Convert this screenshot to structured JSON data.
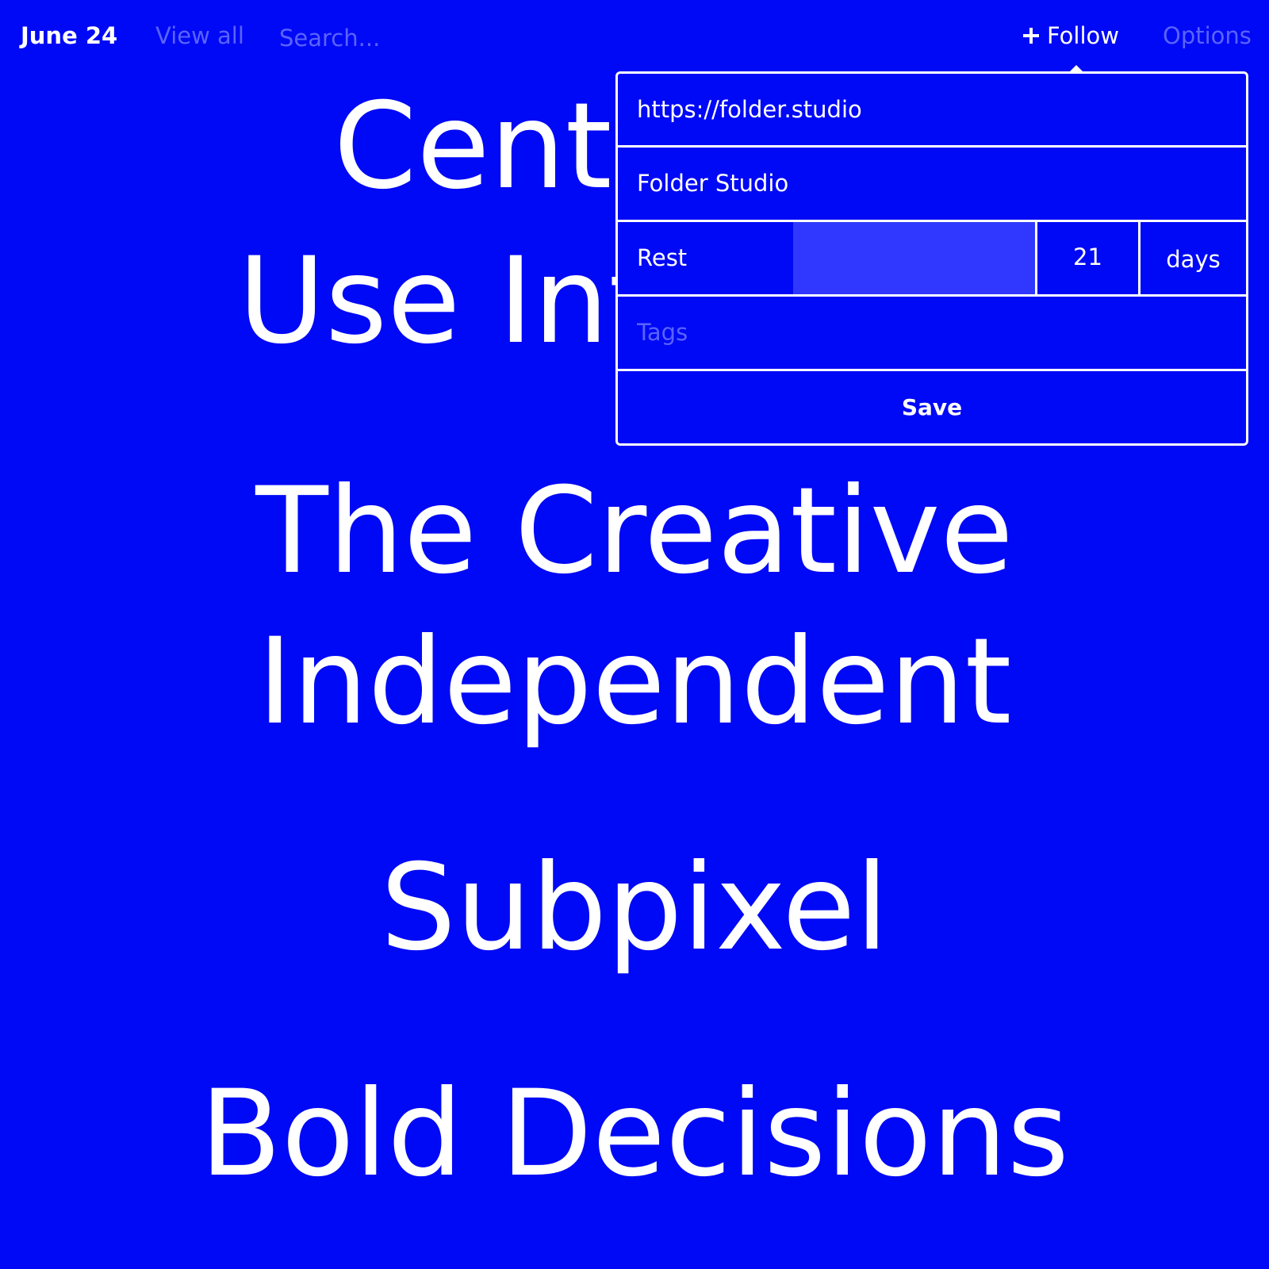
{
  "colors": {
    "background": "#0009f5",
    "foreground": "#ffffff",
    "muted": "#5a63ff",
    "slider_fill": "#3038ff"
  },
  "topbar": {
    "date": "June 24",
    "view_all": "View all",
    "search_placeholder": "Search...",
    "follow_label": "Follow",
    "follow_icon": "plus-icon",
    "options_label": "Options"
  },
  "headlines": [
    "Center for",
    "Use Interface",
    "The Creative",
    "Independent",
    "Subpixel",
    "Bold Decisions"
  ],
  "follow_popover": {
    "url_value": "https://folder.studio",
    "name_value": "Folder Studio",
    "rest_label": "Rest",
    "rest_value": "21",
    "rest_unit": "days",
    "tags_placeholder": "Tags",
    "save_label": "Save"
  }
}
